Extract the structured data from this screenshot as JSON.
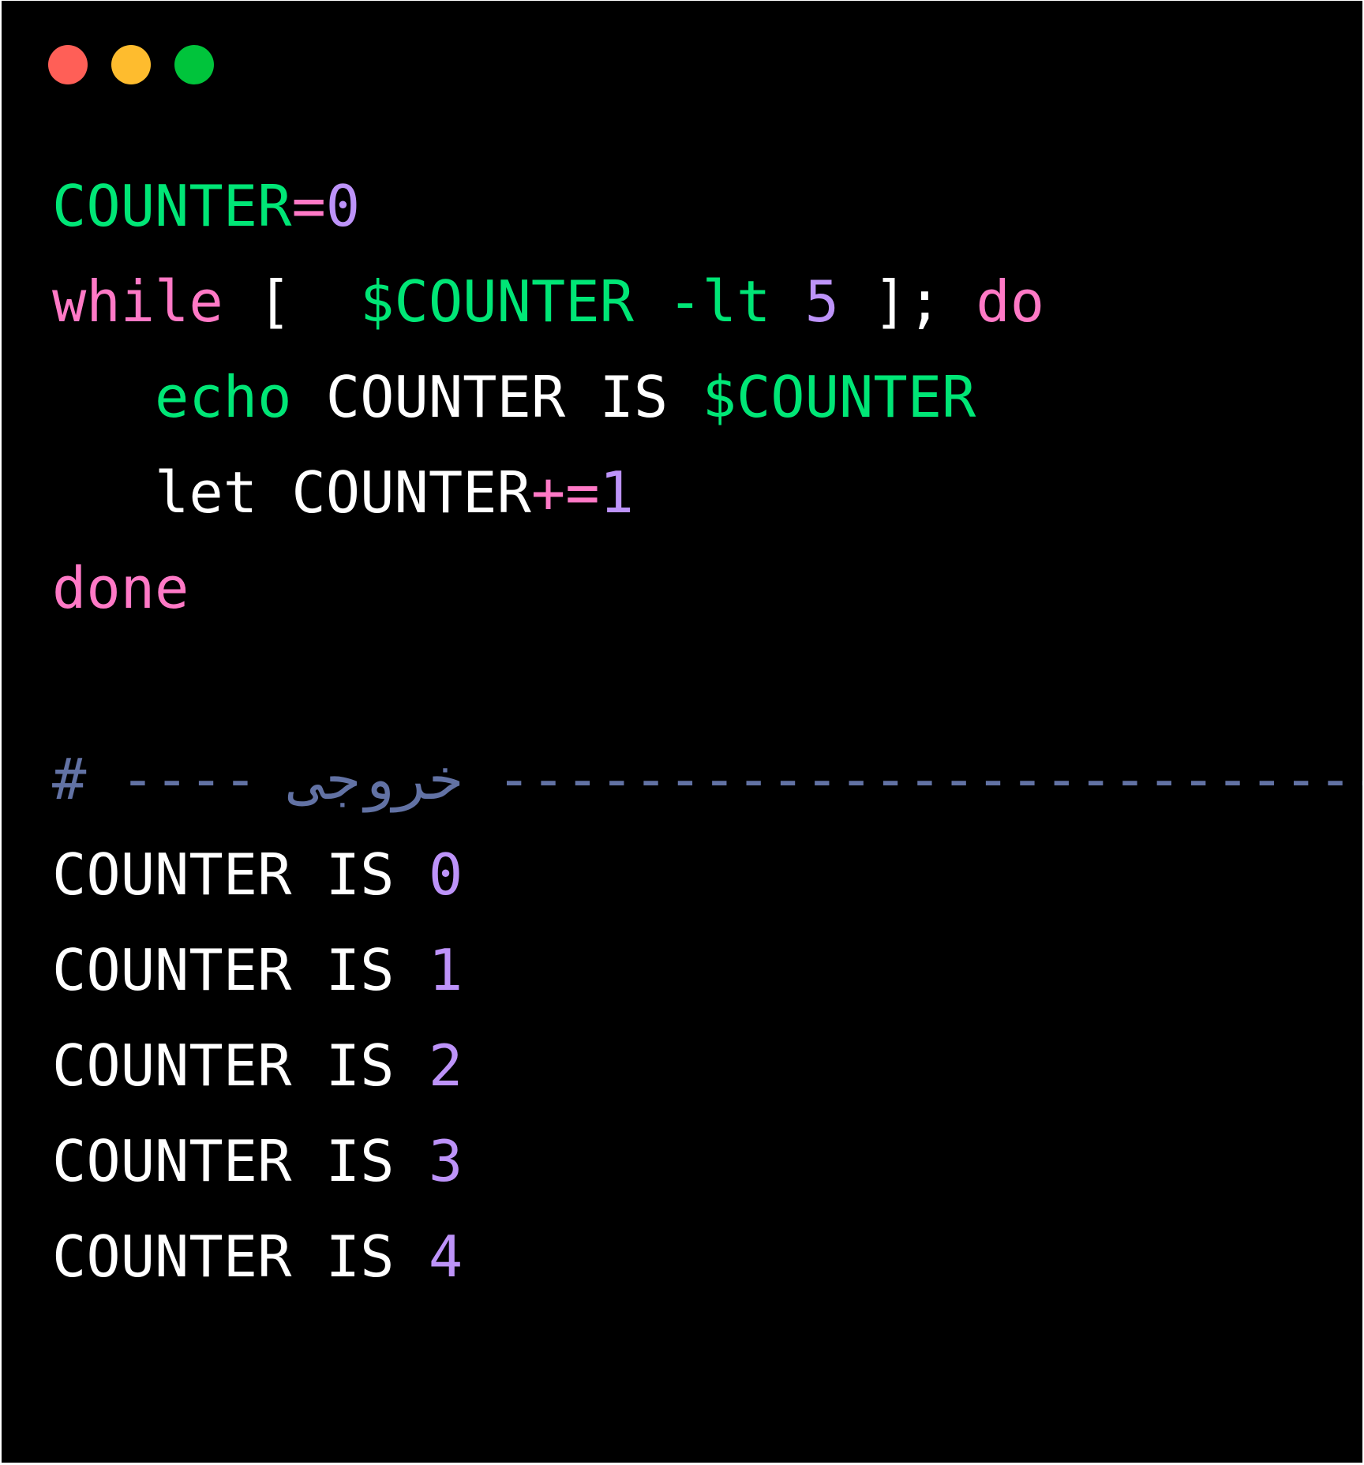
{
  "window": {
    "traffic_lights": [
      {
        "name": "close",
        "color": "#ff5f57"
      },
      {
        "name": "minimize",
        "color": "#febc2e"
      },
      {
        "name": "zoom",
        "color": "#00c43b"
      }
    ]
  },
  "colors": {
    "background": "#000000",
    "default": "#ffffff",
    "variable": "#00e676",
    "keyword": "#ff79c6",
    "number": "#bd93f9",
    "comment": "#6272a4"
  },
  "code_lines": [
    {
      "name": "line-counter-assign",
      "tokens": [
        {
          "text": "COUNTER",
          "kind": "variable"
        },
        {
          "text": "=",
          "kind": "keyword"
        },
        {
          "text": "0",
          "kind": "number"
        }
      ]
    },
    {
      "name": "line-while",
      "tokens": [
        {
          "text": "while",
          "kind": "keyword"
        },
        {
          "text": " [  ",
          "kind": "default"
        },
        {
          "text": "$COUNTER -lt",
          "kind": "variable"
        },
        {
          "text": " ",
          "kind": "default"
        },
        {
          "text": "5",
          "kind": "number"
        },
        {
          "text": " ]; ",
          "kind": "default"
        },
        {
          "text": "do",
          "kind": "keyword"
        }
      ]
    },
    {
      "name": "line-echo",
      "tokens": [
        {
          "text": "   ",
          "kind": "default"
        },
        {
          "text": "echo",
          "kind": "variable"
        },
        {
          "text": " COUNTER IS ",
          "kind": "default"
        },
        {
          "text": "$COUNTER",
          "kind": "variable"
        }
      ]
    },
    {
      "name": "line-let",
      "tokens": [
        {
          "text": "   let COUNTER",
          "kind": "default"
        },
        {
          "text": "+=",
          "kind": "keyword"
        },
        {
          "text": "1",
          "kind": "number"
        }
      ]
    },
    {
      "name": "line-done",
      "tokens": [
        {
          "text": "done",
          "kind": "keyword"
        }
      ]
    },
    {
      "name": "line-blank",
      "tokens": [
        {
          "text": " ",
          "kind": "default"
        }
      ]
    },
    {
      "name": "line-output-comment",
      "tokens": [
        {
          "text": "# ---- خروجی ---------------------------",
          "kind": "comment"
        }
      ]
    },
    {
      "name": "line-output-0",
      "tokens": [
        {
          "text": "COUNTER IS ",
          "kind": "default"
        },
        {
          "text": "0",
          "kind": "number"
        }
      ]
    },
    {
      "name": "line-output-1",
      "tokens": [
        {
          "text": "COUNTER IS ",
          "kind": "default"
        },
        {
          "text": "1",
          "kind": "number"
        }
      ]
    },
    {
      "name": "line-output-2",
      "tokens": [
        {
          "text": "COUNTER IS ",
          "kind": "default"
        },
        {
          "text": "2",
          "kind": "number"
        }
      ]
    },
    {
      "name": "line-output-3",
      "tokens": [
        {
          "text": "COUNTER IS ",
          "kind": "default"
        },
        {
          "text": "3",
          "kind": "number"
        }
      ]
    },
    {
      "name": "line-output-4",
      "tokens": [
        {
          "text": "COUNTER IS ",
          "kind": "default"
        },
        {
          "text": "4",
          "kind": "number"
        }
      ]
    }
  ]
}
